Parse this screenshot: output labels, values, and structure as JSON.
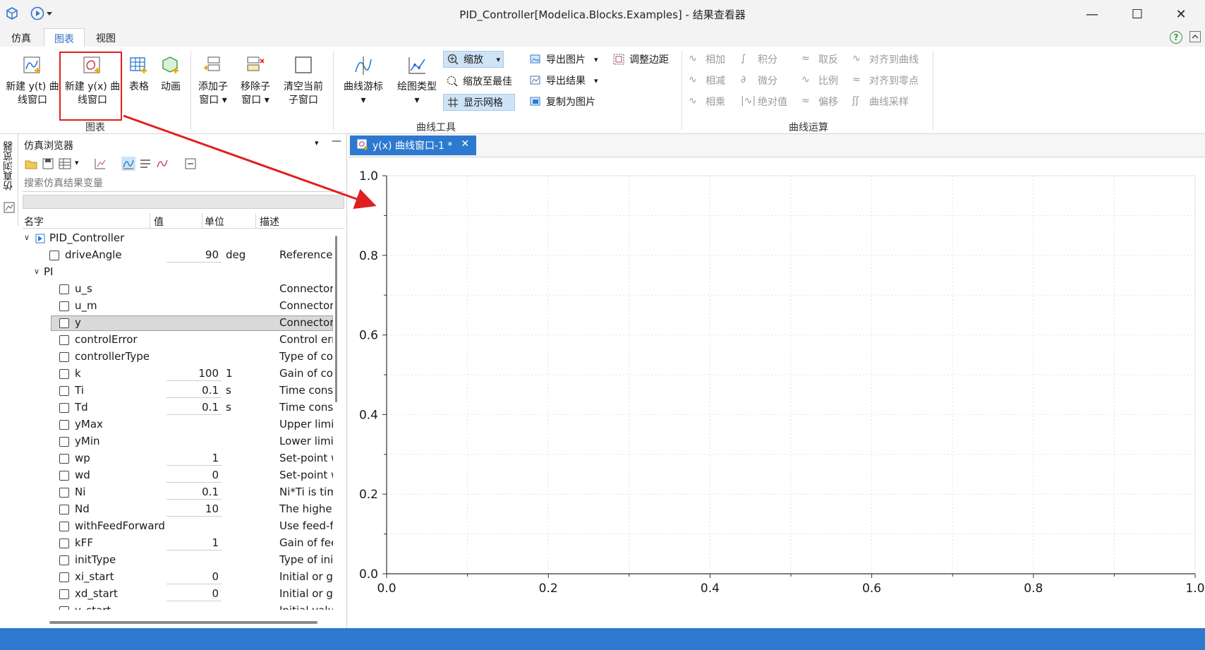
{
  "window": {
    "title": "PID_Controller[Modelica.Blocks.Examples] - 结果查看器",
    "minimize": "—",
    "maximize": "☐",
    "close": "✕"
  },
  "menu": {
    "tabs": [
      "仿真",
      "图表",
      "视图"
    ],
    "active": "图表"
  },
  "ribbon": {
    "chart_group": {
      "label": "图表",
      "new_yt_line1": "新建 y(t) 曲",
      "new_yt_line2": "线窗口",
      "new_yx_line1": "新建 y(x) 曲",
      "new_yx_line2": "线窗口",
      "table": "表格",
      "animation": "动画"
    },
    "curve_tools": {
      "label": "曲线工具",
      "add_sub_line1": "添加子",
      "add_sub_line2": "窗口",
      "remove_sub_line1": "移除子",
      "remove_sub_line2": "窗口",
      "clear_line1": "清空当前",
      "clear_line2": "子窗口",
      "cursor": "曲线游标",
      "plot_type": "绘图类型",
      "zoom": "缩放",
      "zoom_best": "缩放至最佳",
      "show_grid": "显示网格",
      "export_image": "导出图片",
      "export_result": "导出结果",
      "copy_image": "复制为图片",
      "adjust_margin": "调整边距"
    },
    "curve_ops": {
      "label": "曲线运算",
      "add": "相加",
      "subtract": "相减",
      "multiply": "相乘",
      "integrate": "积分",
      "differentiate": "微分",
      "abs": "绝对值",
      "invert": "取反",
      "scale": "比例",
      "offset": "偏移",
      "align_curve": "对齐到曲线",
      "align_zero": "对齐到零点",
      "resample": "曲线采样"
    }
  },
  "sidebar_tab": "仿真浏览器",
  "browser": {
    "title": "仿真浏览器",
    "search_placeholder": "搜索仿真结果变量",
    "columns": [
      "名字",
      "值",
      "单位",
      "描述"
    ],
    "rows": [
      {
        "level": 0,
        "expand": "v",
        "model": true,
        "name": "PID_Controller",
        "value": "",
        "unit": "",
        "desc": ""
      },
      {
        "level": 1,
        "checkbox": true,
        "name": "driveAngle",
        "value": "90",
        "unit": "deg",
        "desc": "Reference"
      },
      {
        "level": 1,
        "expand": "v",
        "name": "PI",
        "value": "",
        "unit": "",
        "desc": ""
      },
      {
        "level": 2,
        "checkbox": true,
        "name": "u_s",
        "value": "",
        "unit": "",
        "desc": "Connector"
      },
      {
        "level": 2,
        "checkbox": true,
        "name": "u_m",
        "value": "",
        "unit": "",
        "desc": "Connector"
      },
      {
        "level": 2,
        "checkbox": true,
        "selected": true,
        "name": "y",
        "value": "",
        "unit": "",
        "desc": "Connector"
      },
      {
        "level": 2,
        "checkbox": true,
        "name": "controlError",
        "value": "",
        "unit": "",
        "desc": "Control err"
      },
      {
        "level": 2,
        "checkbox": true,
        "name": "controllerType",
        "value": "",
        "unit": "",
        "desc": "Type of co"
      },
      {
        "level": 2,
        "checkbox": true,
        "name": "k",
        "value": "100",
        "unit": "1",
        "desc": "Gain of cor"
      },
      {
        "level": 2,
        "checkbox": true,
        "name": "Ti",
        "value": "0.1",
        "unit": "s",
        "desc": "Time const"
      },
      {
        "level": 2,
        "checkbox": true,
        "name": "Td",
        "value": "0.1",
        "unit": "s",
        "desc": "Time const"
      },
      {
        "level": 2,
        "checkbox": true,
        "name": "yMax",
        "value": "",
        "unit": "",
        "desc": "Upper limi"
      },
      {
        "level": 2,
        "checkbox": true,
        "name": "yMin",
        "value": "",
        "unit": "",
        "desc": "Lower limit"
      },
      {
        "level": 2,
        "checkbox": true,
        "name": "wp",
        "value": "1",
        "unit": "",
        "desc": "Set-point w"
      },
      {
        "level": 2,
        "checkbox": true,
        "name": "wd",
        "value": "0",
        "unit": "",
        "desc": "Set-point w"
      },
      {
        "level": 2,
        "checkbox": true,
        "name": "Ni",
        "value": "0.1",
        "unit": "",
        "desc": "Ni*Ti is tim"
      },
      {
        "level": 2,
        "checkbox": true,
        "name": "Nd",
        "value": "10",
        "unit": "",
        "desc": "The higher"
      },
      {
        "level": 2,
        "checkbox": true,
        "name": "withFeedForward",
        "value": "",
        "unit": "",
        "desc": "Use feed-fo"
      },
      {
        "level": 2,
        "checkbox": true,
        "name": "kFF",
        "value": "1",
        "unit": "",
        "desc": "Gain of fee"
      },
      {
        "level": 2,
        "checkbox": true,
        "name": "initType",
        "value": "",
        "unit": "",
        "desc": "Type of ini"
      },
      {
        "level": 2,
        "checkbox": true,
        "name": "xi_start",
        "value": "0",
        "unit": "",
        "desc": "Initial or gu"
      },
      {
        "level": 2,
        "checkbox": true,
        "name": "xd_start",
        "value": "0",
        "unit": "",
        "desc": "Initial or gu"
      },
      {
        "level": 2,
        "checkbox": true,
        "name": "y_start",
        "value": "",
        "unit": "",
        "desc": "Initial value"
      }
    ]
  },
  "plot_window": {
    "tab_label": "y(x) 曲线窗口-1 *",
    "tab_close": "✕"
  },
  "chart_data": {
    "type": "line",
    "series": [],
    "xlim": [
      0.0,
      1.0
    ],
    "ylim": [
      0.0,
      1.0
    ],
    "x_ticks": [
      "0.0",
      "0.2",
      "0.4",
      "0.6",
      "0.8",
      "1.0"
    ],
    "y_ticks": [
      "0.0",
      "0.2",
      "0.4",
      "0.6",
      "0.8",
      "1.0"
    ],
    "grid": true
  },
  "colors": {
    "accent": "#2d79d0",
    "annotation": "#e02020",
    "selected_button": "#cfe3f7"
  }
}
